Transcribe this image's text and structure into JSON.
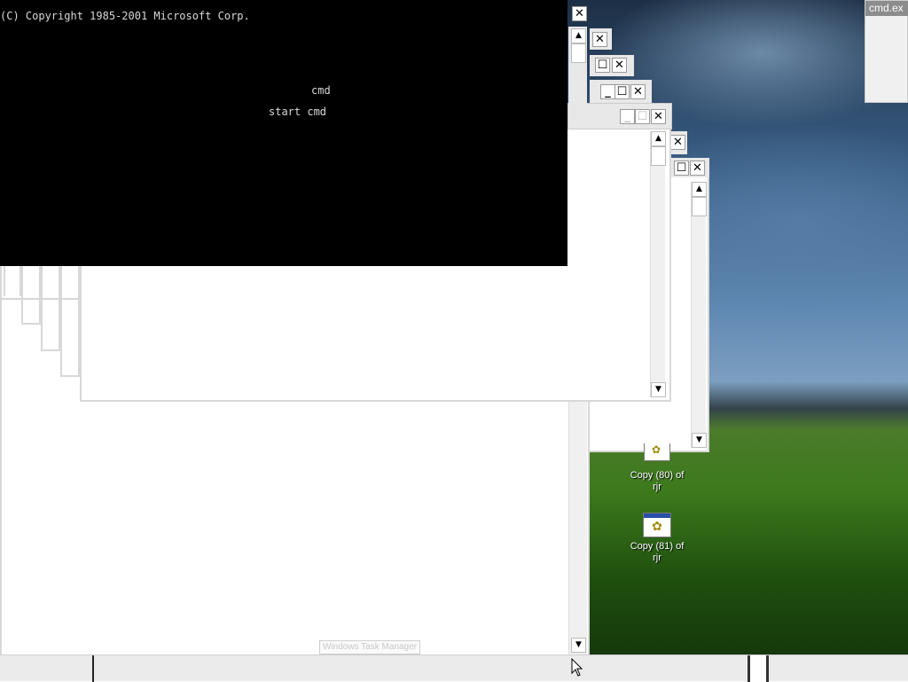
{
  "console": {
    "copyright": "(C) Copyright 1985-2001 Microsoft Corp.",
    "line_cmd": "cmd",
    "line_start": "start cmd"
  },
  "corner_window": {
    "title": "cmd.ex"
  },
  "desktop_icons": [
    {
      "line1": "Copy (80) of",
      "line2": "rjr"
    },
    {
      "line1": "Copy (81) of",
      "line2": "rjr"
    }
  ],
  "tooltip": {
    "text": "Windows Task Manager"
  },
  "buttons": {
    "close": "✕",
    "maximize": "☐",
    "minimize": "_"
  },
  "scroll": {
    "up": "▲",
    "down": "▼"
  }
}
